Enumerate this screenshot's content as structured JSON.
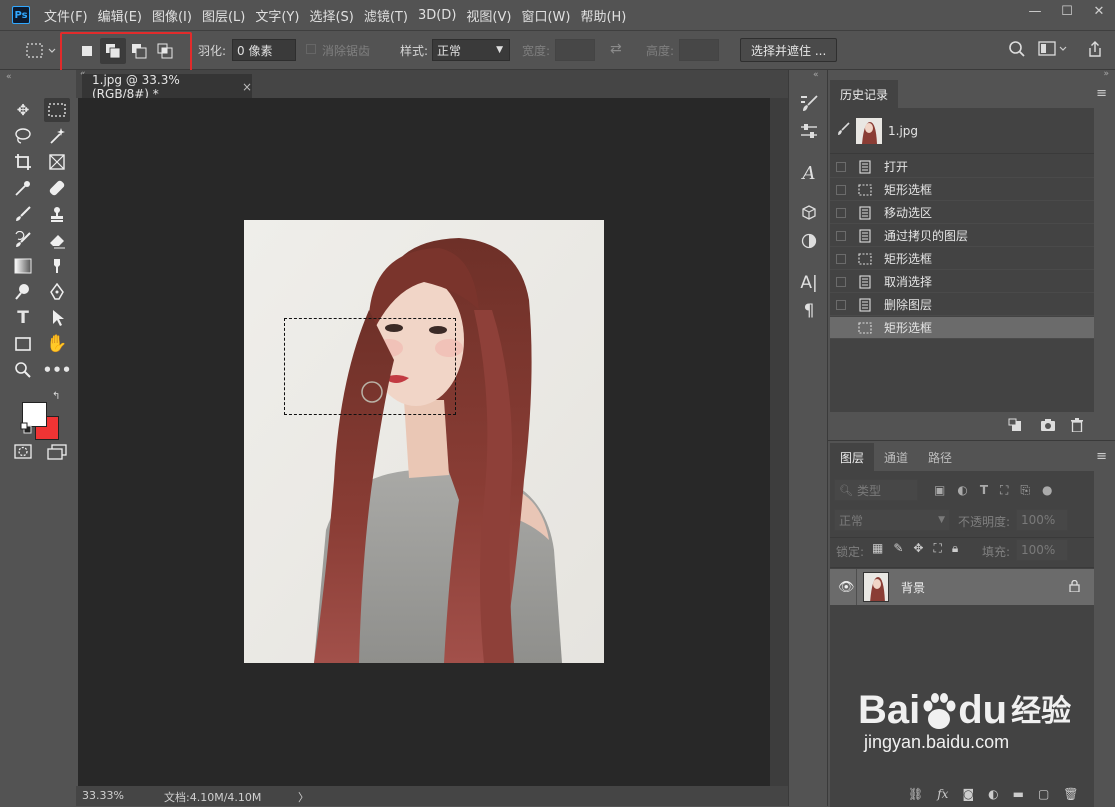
{
  "menu": {
    "logo": "Ps",
    "items": [
      "文件(F)",
      "编辑(E)",
      "图像(I)",
      "图层(L)",
      "文字(Y)",
      "选择(S)",
      "滤镜(T)",
      "3D(D)",
      "视图(V)",
      "窗口(W)",
      "帮助(H)"
    ]
  },
  "window_controls": {
    "minimize": "—",
    "maximize": "☐",
    "close": "✕"
  },
  "options": {
    "feather_label": "羽化:",
    "feather_value": "0 像素",
    "antialias_label": "消除锯齿",
    "style_label": "样式:",
    "style_value": "正常",
    "width_label": "宽度:",
    "height_label": "高度:",
    "select_mask_button": "选择并遮住 ..."
  },
  "document": {
    "tab_title": "1.jpg @ 33.3%(RGB/8#) *",
    "tab_close": "×",
    "zoom": "33.33%",
    "doc_size": "文档:4.10M/4.10M",
    "status_arrow": "〉"
  },
  "history": {
    "tab": "历史记录",
    "snapshot": "1.jpg",
    "items": [
      {
        "label": "打开",
        "icon": "doc"
      },
      {
        "label": "矩形选框",
        "icon": "marquee"
      },
      {
        "label": "移动选区",
        "icon": "doc"
      },
      {
        "label": "通过拷贝的图层",
        "icon": "doc"
      },
      {
        "label": "矩形选框",
        "icon": "marquee"
      },
      {
        "label": "取消选择",
        "icon": "doc"
      },
      {
        "label": "删除图层",
        "icon": "doc"
      },
      {
        "label": "矩形选框",
        "icon": "marquee",
        "selected": true
      }
    ]
  },
  "layers": {
    "tabs": [
      "图层",
      "通道",
      "路径"
    ],
    "filter_placeholder": "类型",
    "blend_mode": "正常",
    "opacity_label": "不透明度:",
    "opacity_value": "100%",
    "lock_label": "锁定:",
    "fill_label": "填充:",
    "fill_value": "100%",
    "items": [
      {
        "name": "背景",
        "locked": true
      }
    ]
  },
  "watermark": {
    "brand": "Bai",
    "brand2": "du",
    "cn": "经验",
    "url": "jingyan.baidu.com"
  },
  "colors": {
    "foreground": "#ffffff",
    "background": "#f03434",
    "highlight_box": "#e22b2b"
  }
}
